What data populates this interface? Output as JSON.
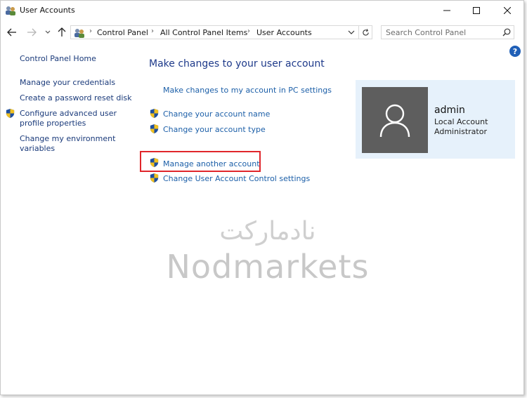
{
  "window": {
    "title": "User Accounts"
  },
  "address_bar": {
    "crumbs": [
      "Control Panel",
      "All Control Panel Items",
      "User Accounts"
    ]
  },
  "search": {
    "placeholder": "Search Control Panel"
  },
  "help": {
    "label": "?"
  },
  "sidebar": {
    "items": [
      {
        "label": "Control Panel Home",
        "icon": null
      },
      {
        "label": "Manage your credentials",
        "icon": null
      },
      {
        "label": "Create a password reset disk",
        "icon": null
      },
      {
        "label": "Configure advanced user profile properties",
        "icon": "uac-shield-icon"
      },
      {
        "label": "Change my environment variables",
        "icon": null
      }
    ]
  },
  "main": {
    "title": "Make changes to your user account",
    "tasks": [
      {
        "label": "Make changes to my account in PC settings",
        "icon": null
      },
      {
        "label": "Change your account name",
        "icon": "uac-shield-icon"
      },
      {
        "label": "Change your account type",
        "icon": "uac-shield-icon"
      },
      {
        "label": "Manage another account",
        "icon": "uac-shield-icon",
        "highlighted": true
      },
      {
        "label": "Change User Account Control settings",
        "icon": "uac-shield-icon"
      }
    ]
  },
  "account": {
    "name": "admin",
    "type": "Local Account",
    "role": "Administrator"
  },
  "watermark": {
    "persian": "نادمارکت",
    "english": "Nodmarkets"
  },
  "colors": {
    "link": "#1c5fa8",
    "title": "#1e3a8a",
    "highlight": "#e0262b",
    "card_bg": "#e6f1fb",
    "avatar_bg": "#5e5e5e"
  }
}
